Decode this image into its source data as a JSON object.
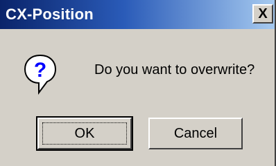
{
  "window": {
    "title": "CX-Position",
    "close_label": "X"
  },
  "dialog": {
    "icon": "question-icon",
    "message": "Do you want to overwrite?"
  },
  "buttons": {
    "ok_label": "OK",
    "cancel_label": "Cancel"
  },
  "colors": {
    "title_bar_start": "#0a246a",
    "title_bar_end": "#a6caf0",
    "dialog_bg": "#d4d0c8"
  }
}
